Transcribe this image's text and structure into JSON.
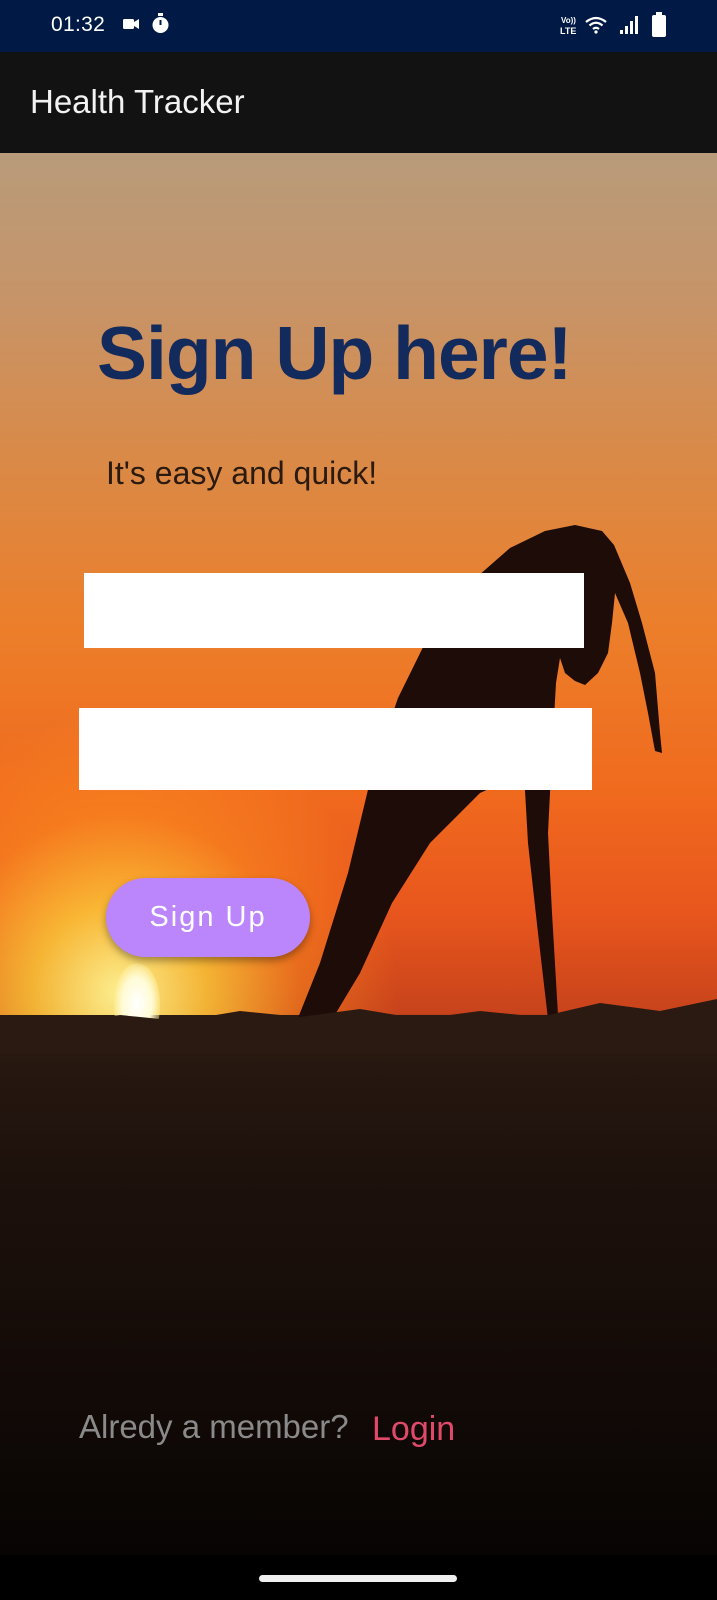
{
  "status_bar": {
    "time": "01:32",
    "icons": [
      "video-camera-icon",
      "timer-icon",
      "volte-icon",
      "wifi-icon",
      "cellular-signal-icon",
      "battery-icon"
    ],
    "volte_label": "VoLTE",
    "background_color": "#011a45"
  },
  "app_bar": {
    "title": "Health Tracker",
    "background_color": "#121212"
  },
  "main": {
    "heading": "Sign Up here!",
    "heading_color": "#132a5c",
    "subheading": "It's easy and quick!",
    "fields": [
      {
        "value": "",
        "placeholder": ""
      },
      {
        "value": "",
        "placeholder": ""
      }
    ],
    "signup_button_label": "Sign Up",
    "signup_button_color": "#bb86fc",
    "member_prompt": "Alredy a member?",
    "login_link": "Login",
    "login_link_color": "#e04a6a"
  }
}
